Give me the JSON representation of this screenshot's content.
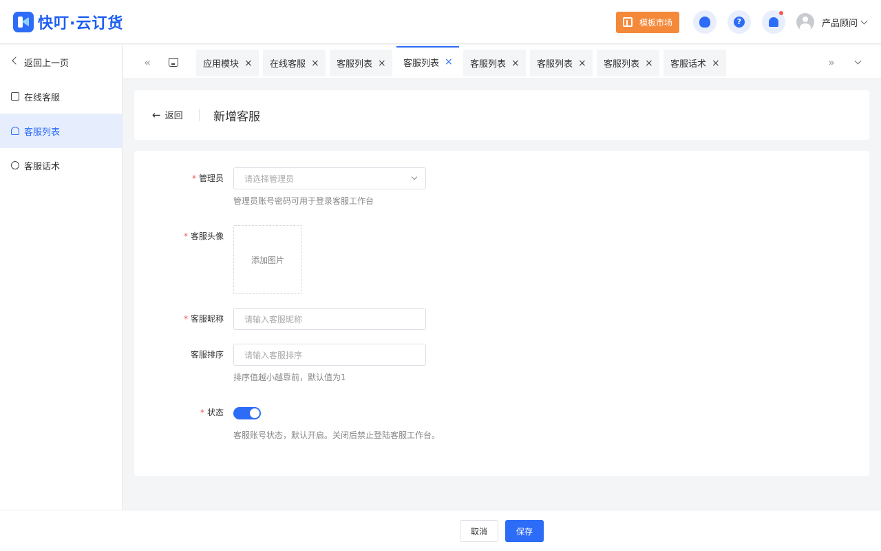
{
  "header": {
    "logo_text": "快叮·云订货",
    "market_label": "模板市场",
    "user_name": "产品顾问",
    "help_glyph": "?",
    "colors": {
      "brand": "#2d6cf6",
      "market": "#f5893a",
      "notify_dot": "#f55656"
    }
  },
  "sidebar": {
    "back_label": "返回上一页",
    "items": [
      {
        "label": "在线客服",
        "icon": "message-icon",
        "active": false
      },
      {
        "label": "客服列表",
        "icon": "users-icon",
        "active": true
      },
      {
        "label": "客服话术",
        "icon": "chat-icon",
        "active": false
      }
    ]
  },
  "tabs": [
    {
      "label": "应用模块",
      "active": false
    },
    {
      "label": "在线客服",
      "active": false
    },
    {
      "label": "客服列表",
      "active": false
    },
    {
      "label": "客服列表",
      "active": true
    },
    {
      "label": "客服列表",
      "active": false
    },
    {
      "label": "客服列表",
      "active": false
    },
    {
      "label": "客服列表",
      "active": false
    },
    {
      "label": "客服话术",
      "active": false
    }
  ],
  "tab_close_glyph": "×",
  "page": {
    "back_label": "返回",
    "title": "新增客服",
    "arrow_glyph": "←"
  },
  "form": {
    "required_mark": "*",
    "admin": {
      "label": "管理员",
      "placeholder": "请选择管理员",
      "hint": "管理员账号密码可用于登录客服工作台"
    },
    "avatar": {
      "label": "客服头像",
      "upload_label": "添加图片"
    },
    "nickname": {
      "label": "客服昵称",
      "placeholder": "请输入客服昵称"
    },
    "order": {
      "label": "客服排序",
      "placeholder": "请输入客服排序",
      "hint": "排序值越小越靠前，默认值为1"
    },
    "status": {
      "label": "状态",
      "enabled": true,
      "hint": "客服账号状态，默认开启。关闭后禁止登陆客服工作台。"
    }
  },
  "footer": {
    "cancel_label": "取消",
    "save_label": "保存"
  }
}
